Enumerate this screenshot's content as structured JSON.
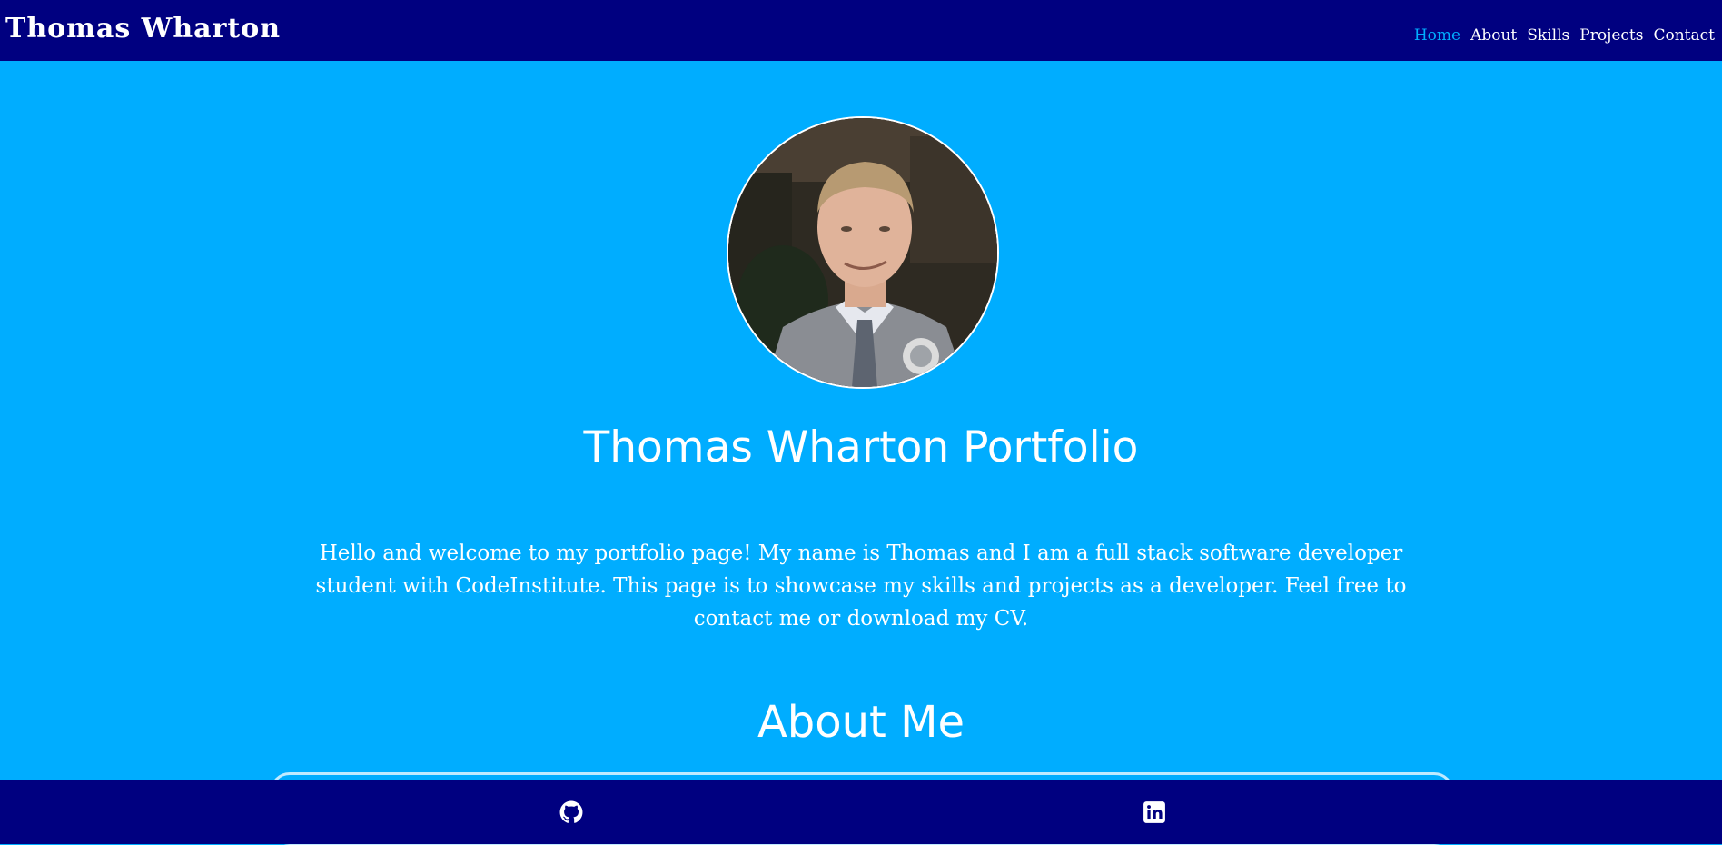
{
  "header": {
    "brand": "Thomas Wharton",
    "nav": [
      {
        "label": "Home",
        "active": true
      },
      {
        "label": "About",
        "active": false
      },
      {
        "label": "Skills",
        "active": false
      },
      {
        "label": "Projects",
        "active": false
      },
      {
        "label": "Contact",
        "active": false
      }
    ]
  },
  "hero": {
    "avatar_icon": "profile-photo",
    "title": "Thomas Wharton Portfolio",
    "intro": "Hello and welcome to my portfolio page! My name is Thomas and I am a full stack software developer student with CodeInstitute. This page is to showcase my skills and projects as a developer. Feel free to contact me or download my CV."
  },
  "about": {
    "title": "About Me"
  },
  "footer": {
    "icons": [
      "github-icon",
      "linkedin-icon"
    ]
  },
  "colors": {
    "nav_background": "#000080",
    "page_background": "#00adff",
    "text": "#ffffff",
    "active_link": "#00adff"
  }
}
